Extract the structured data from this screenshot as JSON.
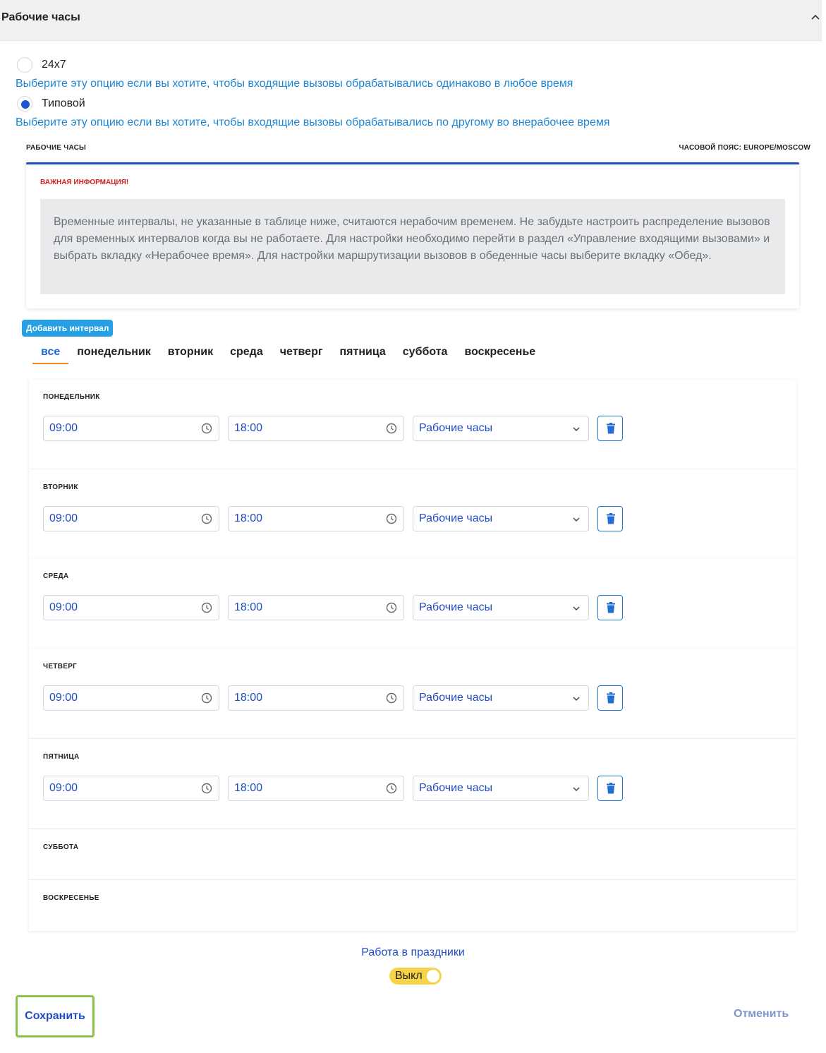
{
  "section": {
    "title": "Рабочие часы"
  },
  "mode": {
    "options": [
      {
        "label": "24x7",
        "hint": "Выберите эту опцию если вы хотите, чтобы входящие вызовы обрабатывались одинаково в любое время",
        "selected": false
      },
      {
        "label": "Типовой",
        "hint": "Выберите эту опцию если вы хотите, чтобы входящие вызовы обрабатывались по другому во внерабочее время",
        "selected": true
      }
    ]
  },
  "schedule": {
    "caption_left": "РАБОЧИЕ ЧАСЫ",
    "caption_right": "ЧАСОВОЙ ПОЯС: EUROPE/MOSCOW"
  },
  "info": {
    "title": "ВАЖНАЯ ИНФОРМАЦИЯ!",
    "text": "Временные интервалы, не указанные в таблице ниже, считаются нерабочим временем. Не забудьте настроить распределение вызовов для временных интервалов когда вы не работаете. Для настройки необходимо перейти в раздел «Управление входящими вызовами» и выбрать вкладку «Нерабочее время». Для настройки маршрутизации вызовов в обеденные часы выберите вкладку «Обед»."
  },
  "add_interval_label": "Добавить интервал",
  "tabs": [
    "все",
    "понедельник",
    "вторник",
    "среда",
    "четверг",
    "пятница",
    "суббота",
    "воскресенье"
  ],
  "active_tab": "все",
  "days": [
    {
      "name": "ПОНЕДЕЛЬНИК",
      "start": "09:00",
      "end": "18:00",
      "type": "Рабочие часы"
    },
    {
      "name": "ВТОРНИК",
      "start": "09:00",
      "end": "18:00",
      "type": "Рабочие часы"
    },
    {
      "name": "СРЕДА",
      "start": "09:00",
      "end": "18:00",
      "type": "Рабочие часы"
    },
    {
      "name": "ЧЕТВЕРГ",
      "start": "09:00",
      "end": "18:00",
      "type": "Рабочие часы"
    },
    {
      "name": "ПЯТНИЦА",
      "start": "09:00",
      "end": "18:00",
      "type": "Рабочие часы"
    },
    {
      "name": "СУББОТА"
    },
    {
      "name": "ВОСКРЕСЕНЬЕ"
    }
  ],
  "holidays": {
    "title": "Работа в праздники",
    "toggle_label": "Выкл",
    "enabled": false
  },
  "actions": {
    "save": "Сохранить",
    "cancel": "Отменить"
  },
  "colors": {
    "accent": "#1f4cc4",
    "link": "#1c86d6",
    "tab_underline": "#f08a24",
    "toggle_off": "#f7d349",
    "save_border": "#8bc34a",
    "warning": "#d32020"
  }
}
